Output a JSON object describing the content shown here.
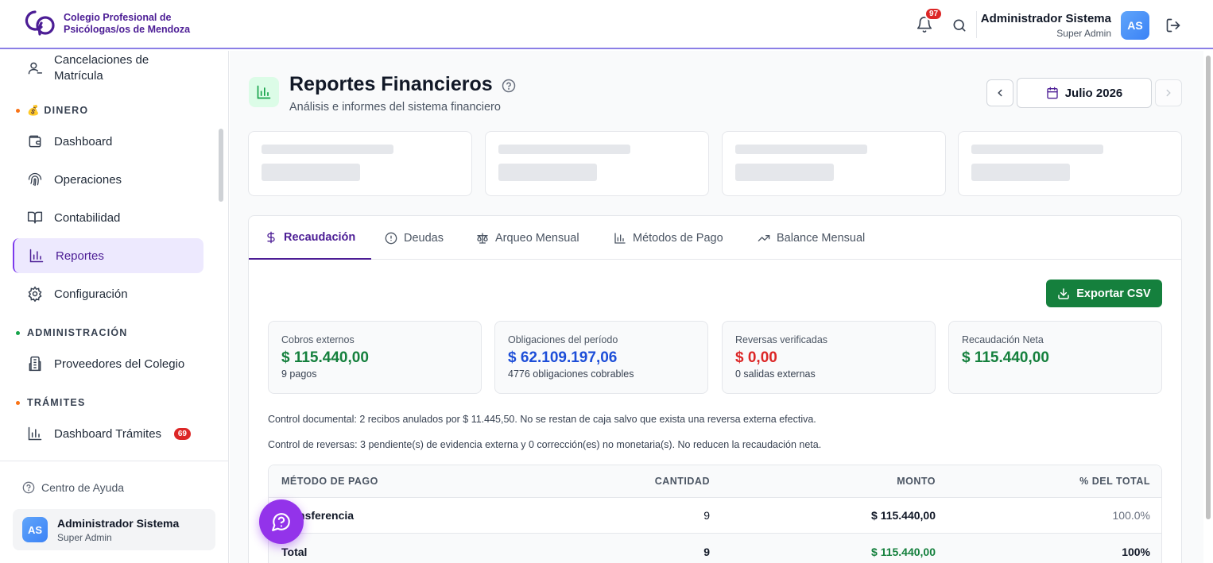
{
  "header": {
    "org_name_line1": "Colegio Profesional de",
    "org_name_line2": "Psicólogas/os de Mendoza",
    "notifications_count": "97",
    "user_name": "Administrador Sistema",
    "user_role": "Super Admin",
    "avatar_initials": "AS"
  },
  "sidebar": {
    "top_item": {
      "line1": "Cancelaciones de",
      "line2": "Matrícula",
      "icon": "user-minus-icon"
    },
    "section_dinero": "💰 DINERO",
    "dinero_items": [
      {
        "label": "Dashboard",
        "icon": "wallet-icon"
      },
      {
        "label": "Operaciones",
        "icon": "fingerprint-icon"
      },
      {
        "label": "Contabilidad",
        "icon": "book-open-icon"
      },
      {
        "label": "Reportes",
        "icon": "bar-chart-icon"
      },
      {
        "label": "Configuración",
        "icon": "gear-icon"
      }
    ],
    "section_admin": "ADMINISTRACIÓN",
    "admin_items": [
      {
        "label": "Proveedores del Colegio",
        "icon": "building-icon"
      }
    ],
    "section_tramites": "TRÁMITES",
    "tramites_items": [
      {
        "label": "Dashboard Trámites",
        "icon": "bar-chart-icon",
        "badge": "69"
      }
    ],
    "help_label": "Centro de Ayuda",
    "user_name": "Administrador Sistema",
    "user_role": "Super Admin",
    "avatar_initials": "AS",
    "colors": {
      "dinero_dot": "#f97316",
      "admin_dot": "#16a34a",
      "tramites_dot": "#f97316"
    }
  },
  "page": {
    "title": "Reportes Financieros",
    "subtitle": "Análisis e informes del sistema financiero",
    "month": "Julio 2026"
  },
  "tabs": [
    {
      "label": "Recaudación",
      "icon": "dollar-icon"
    },
    {
      "label": "Deudas",
      "icon": "alert-circle-icon"
    },
    {
      "label": "Arqueo Mensual",
      "icon": "scale-icon"
    },
    {
      "label": "Métodos de Pago",
      "icon": "bar-chart-icon"
    },
    {
      "label": "Balance Mensual",
      "icon": "trending-up-icon"
    }
  ],
  "export_label": "Exportar CSV",
  "kpis": [
    {
      "label": "Cobros externos",
      "value": "$ 115.440,00",
      "sub": "9 pagos",
      "color": "#15803d"
    },
    {
      "label": "Obligaciones del período",
      "value": "$ 62.109.197,06",
      "sub": "4776 obligaciones cobrables",
      "color": "#1d4ed8"
    },
    {
      "label": "Reversas verificadas",
      "value": "$ 0,00",
      "sub": "0 salidas externas",
      "color": "#dc2626"
    },
    {
      "label": "Recaudación Neta",
      "value": "$ 115.440,00",
      "sub": "",
      "color": "#15803d"
    }
  ],
  "notes": [
    "Control documental: 2 recibos anulados por $ 11.445,50. No se restan de caja salvo que exista una reversa externa efectiva.",
    "Control de reversas: 3 pendiente(s) de evidencia externa y 0 corrección(es) no monetaria(s). No reducen la recaudación neta."
  ],
  "table": {
    "headers": [
      "MÉTODO DE PAGO",
      "CANTIDAD",
      "MONTO",
      "% DEL TOTAL"
    ],
    "rows": [
      [
        "Transferencia",
        "9",
        "$ 115.440,00",
        "100.0%"
      ]
    ],
    "total": [
      "Total",
      "9",
      "$ 115.440,00",
      "100%"
    ]
  }
}
